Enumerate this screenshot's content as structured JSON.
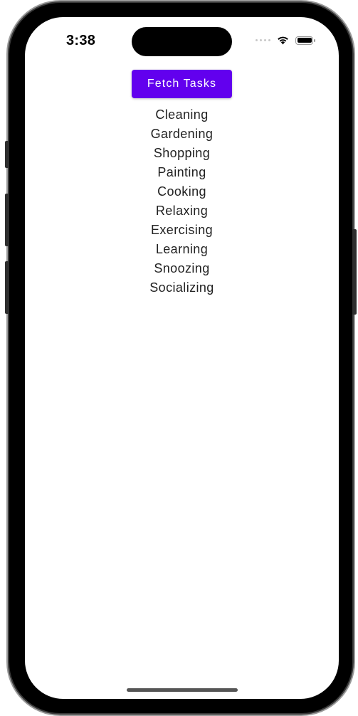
{
  "status_bar": {
    "time": "3:38",
    "icons": [
      "signal-dots-icon",
      "wifi-icon",
      "battery-icon"
    ]
  },
  "app": {
    "fetch_button_label": "Fetch Tasks",
    "accent_color": "#6200ee",
    "tasks": [
      "Cleaning",
      "Gardening",
      "Shopping",
      "Painting",
      "Cooking",
      "Relaxing",
      "Exercising",
      "Learning",
      "Snoozing",
      "Socializing"
    ]
  }
}
